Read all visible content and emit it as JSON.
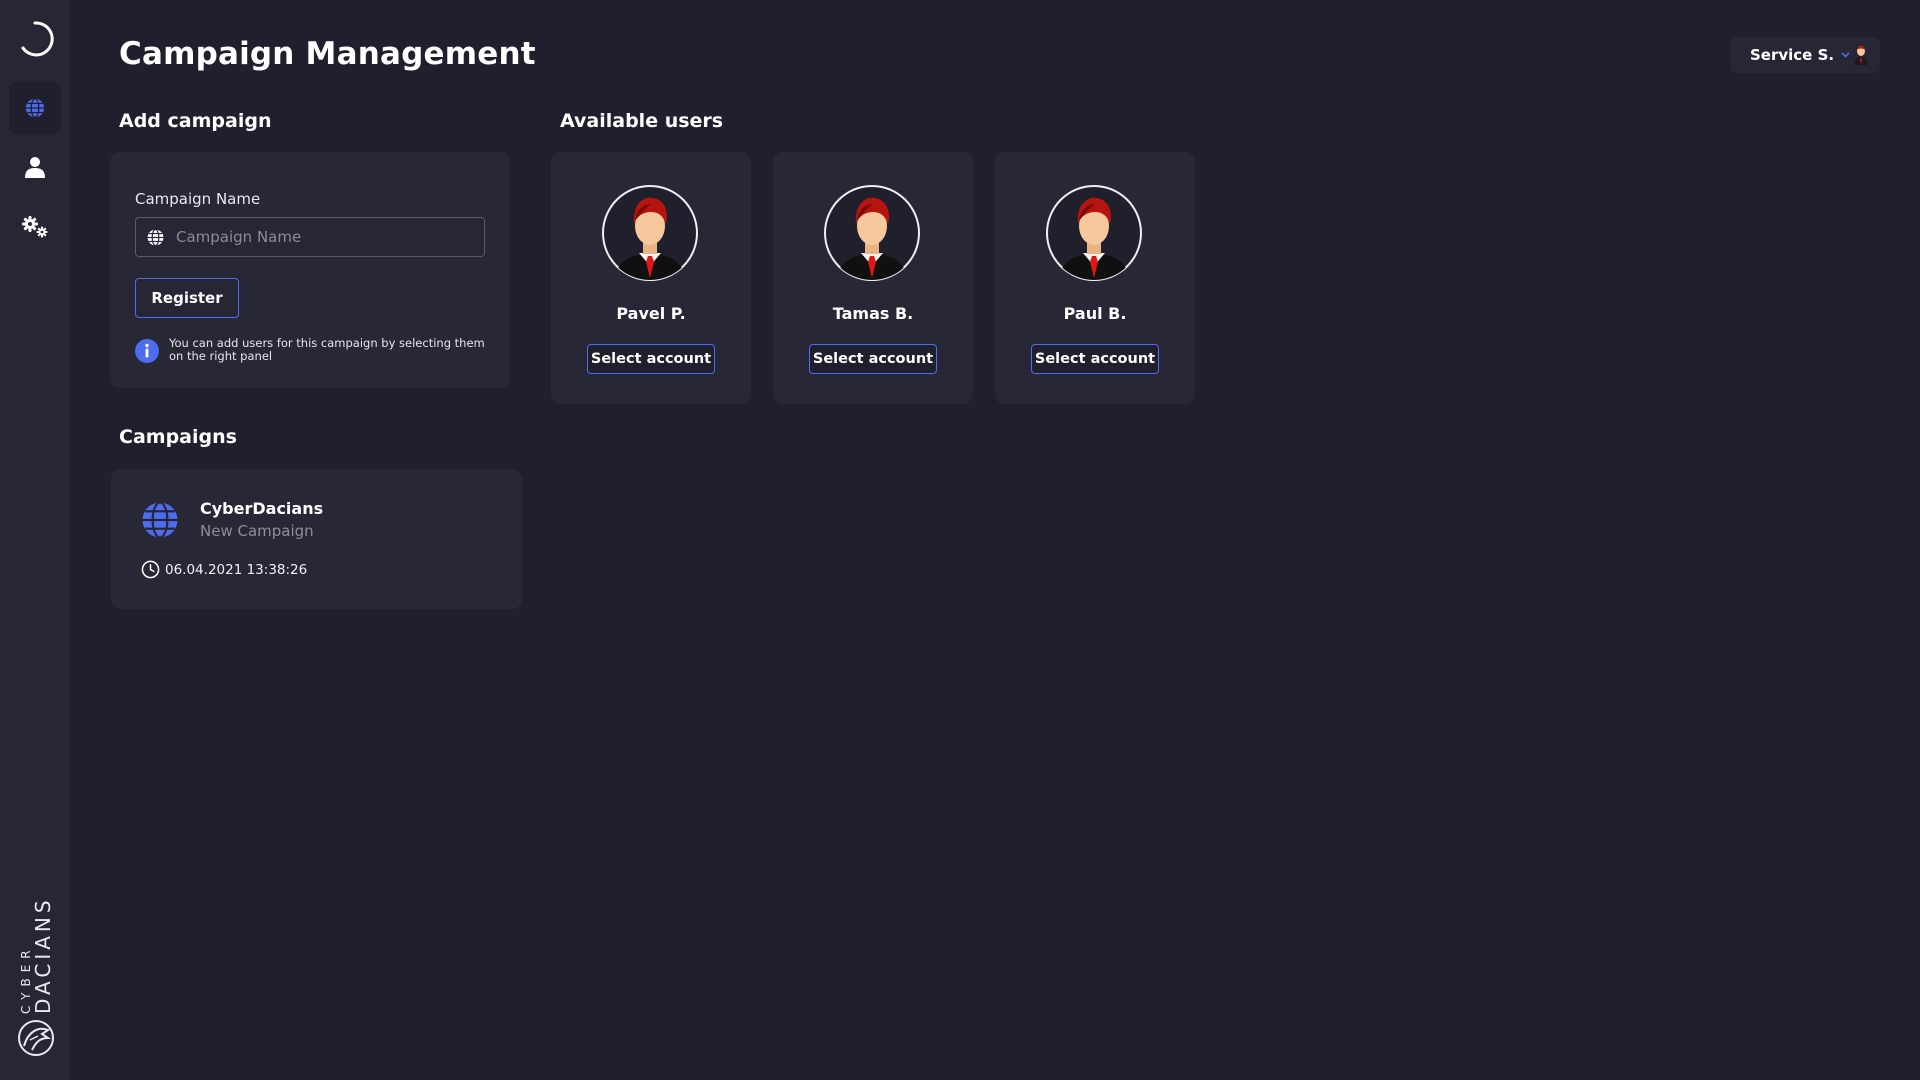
{
  "header": {
    "title": "Campaign Management",
    "user_name": "Service S."
  },
  "sidebar": {
    "items": [
      {
        "name": "logo",
        "icon": "spinner-logo-icon"
      },
      {
        "name": "campaigns",
        "icon": "globe-icon",
        "active": true
      },
      {
        "name": "users",
        "icon": "user-icon"
      },
      {
        "name": "settings",
        "icon": "gears-icon"
      }
    ],
    "brand_top": "CYBER",
    "brand_bottom": "DACIANS"
  },
  "add_campaign": {
    "title": "Add campaign",
    "field_label": "Campaign Name",
    "placeholder": "Campaign Name",
    "value": "",
    "register_label": "Register",
    "info_text": "You can add users for this campaign by selecting them on the right panel"
  },
  "available_users": {
    "title": "Available users",
    "users": [
      {
        "name": "Pavel P.",
        "button": "Select account"
      },
      {
        "name": "Tamas B.",
        "button": "Select account"
      },
      {
        "name": "Paul B.",
        "button": "Select account"
      }
    ]
  },
  "campaigns": {
    "title": "Campaigns",
    "items": [
      {
        "name": "CyberDacians",
        "subtitle": "New Campaign",
        "date": "06.04.2021 13:38:26"
      }
    ]
  },
  "colors": {
    "background": "#1f1f2d",
    "panel": "#272736",
    "accent": "#4d6cf0"
  }
}
